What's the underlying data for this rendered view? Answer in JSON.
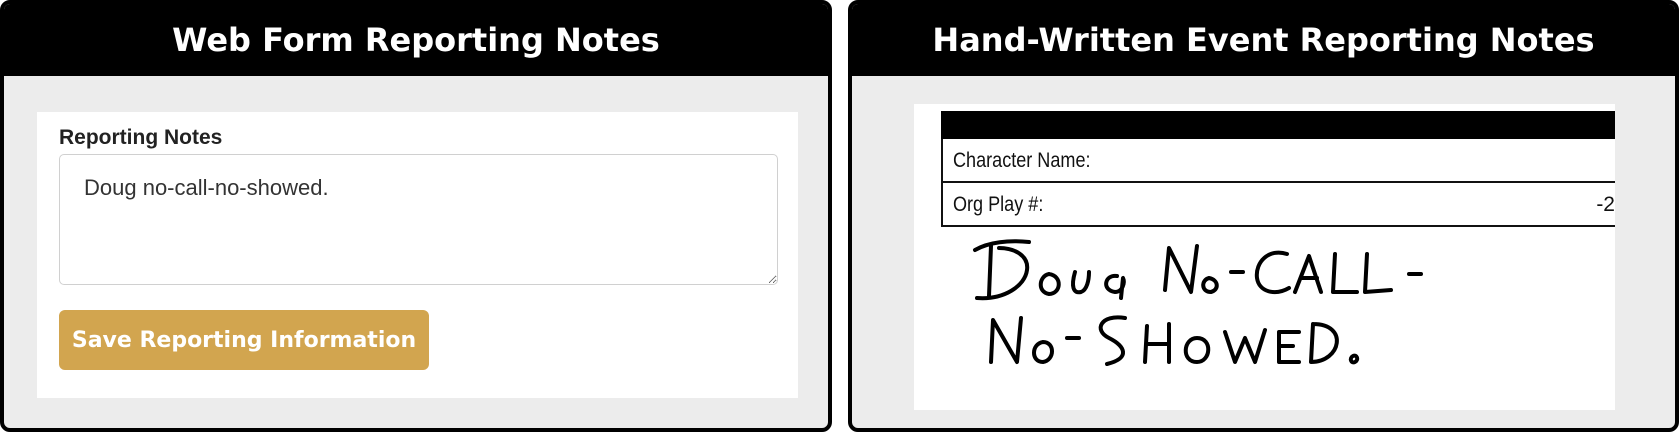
{
  "left_panel": {
    "title": "Web Form Reporting Notes",
    "field_label": "Reporting Notes",
    "notes_value": "Doug no-call-no-showed.",
    "save_button_label": "Save Reporting Information",
    "button_color": "#d2a54f"
  },
  "right_panel": {
    "title": "Hand-Written Event Reporting Notes",
    "row1_label": "Character Name:",
    "row2_label": "Org Play #:",
    "row2_number": "-2",
    "handwritten_lines": [
      "Doug No-Call-",
      "No-Showed."
    ]
  }
}
